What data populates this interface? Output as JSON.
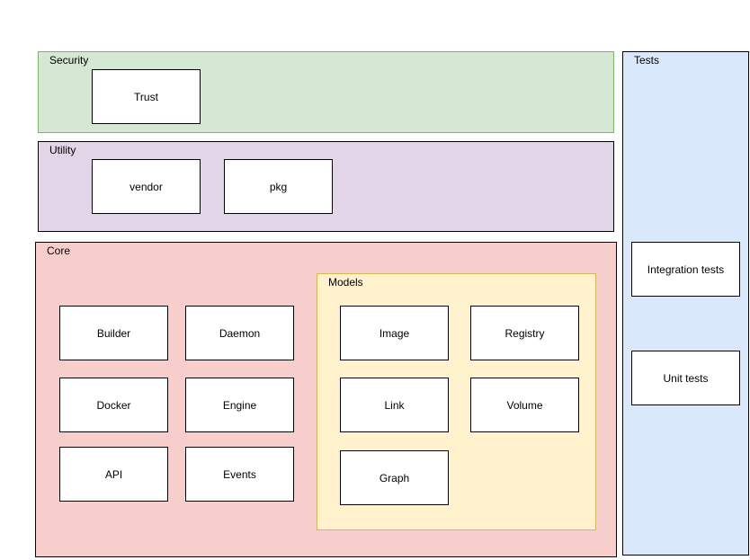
{
  "groups": {
    "security": {
      "label": "Security",
      "fill": "#d5e8d4",
      "stroke": "#82b366",
      "items": [
        "Trust"
      ]
    },
    "utility": {
      "label": "Utility",
      "fill": "#e1d5e7",
      "stroke": "#000000",
      "items": [
        "vendor",
        "pkg"
      ]
    },
    "core": {
      "label": "Core",
      "fill": "#f8cecc",
      "stroke": "#000000",
      "items": [
        "Builder",
        "Daemon",
        "Docker",
        "Engine",
        "API",
        "Events"
      ]
    },
    "models": {
      "label": "Models",
      "fill": "#fff2cc",
      "stroke": "#d6b656",
      "items": [
        "Image",
        "Registry",
        "Link",
        "Volume",
        "Graph"
      ]
    },
    "tests": {
      "label": "Tests",
      "fill": "#dae8fc",
      "stroke": "#000000",
      "items": [
        "Integration tests",
        "Unit tests"
      ]
    }
  }
}
